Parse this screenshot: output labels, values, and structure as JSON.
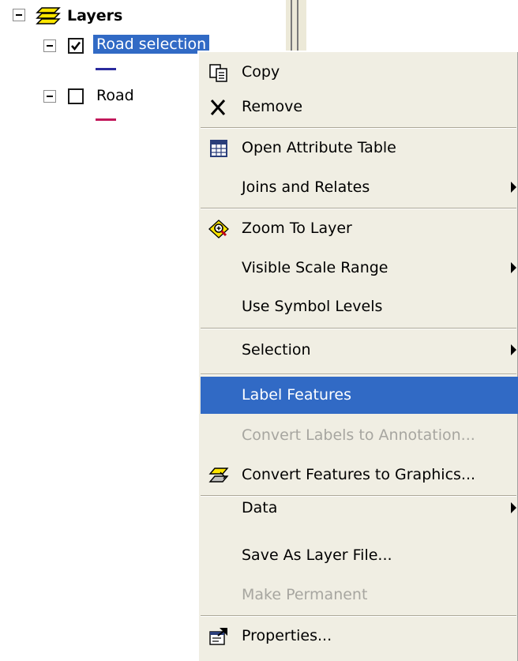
{
  "toc": {
    "root_label": "Layers",
    "layers": [
      {
        "label": "Road selection",
        "checked": true,
        "selected": true,
        "symbol_color": "#2b2b9e"
      },
      {
        "label": "Road",
        "checked": false,
        "selected": false,
        "symbol_color": "#c2185b"
      }
    ]
  },
  "context_menu": {
    "items": [
      {
        "label": "Copy",
        "icon": "copy-icon",
        "submenu": false,
        "enabled": true,
        "highlighted": false
      },
      {
        "label": "Remove",
        "icon": "remove-x-icon",
        "submenu": false,
        "enabled": true,
        "highlighted": false
      },
      {
        "label": "Open Attribute Table",
        "icon": "attribute-table-icon",
        "submenu": false,
        "enabled": true,
        "highlighted": false
      },
      {
        "label": "Joins and Relates",
        "icon": "",
        "submenu": true,
        "enabled": true,
        "highlighted": false
      },
      {
        "label": "Zoom To Layer",
        "icon": "zoom-to-layer-icon",
        "submenu": false,
        "enabled": true,
        "highlighted": false
      },
      {
        "label": "Visible Scale Range",
        "icon": "",
        "submenu": true,
        "enabled": true,
        "highlighted": false
      },
      {
        "label": "Use Symbol Levels",
        "icon": "",
        "submenu": false,
        "enabled": true,
        "highlighted": false
      },
      {
        "label": "Selection",
        "icon": "",
        "submenu": true,
        "enabled": true,
        "highlighted": false
      },
      {
        "label": "Label Features",
        "icon": "",
        "submenu": false,
        "enabled": true,
        "highlighted": true
      },
      {
        "label": "Convert Labels to Annotation...",
        "icon": "",
        "submenu": false,
        "enabled": false,
        "highlighted": false
      },
      {
        "label": "Convert Features to Graphics...",
        "icon": "convert-features-icon",
        "submenu": false,
        "enabled": true,
        "highlighted": false
      },
      {
        "label": "Data",
        "icon": "",
        "submenu": true,
        "enabled": true,
        "highlighted": false
      },
      {
        "label": "Save As Layer File...",
        "icon": "",
        "submenu": false,
        "enabled": true,
        "highlighted": false
      },
      {
        "label": "Make Permanent",
        "icon": "",
        "submenu": false,
        "enabled": false,
        "highlighted": false
      },
      {
        "label": "Properties...",
        "icon": "properties-icon",
        "submenu": false,
        "enabled": true,
        "highlighted": false
      }
    ]
  }
}
